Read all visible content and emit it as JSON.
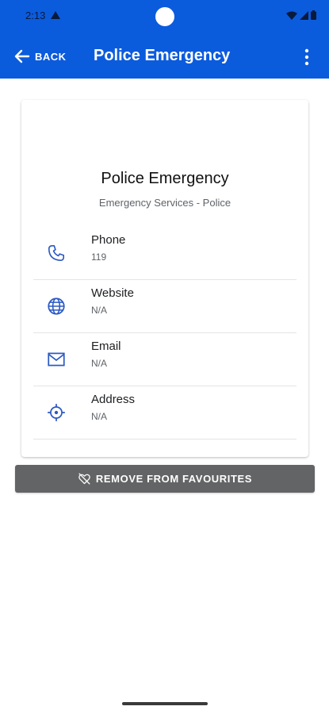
{
  "status_bar": {
    "time": "2:13"
  },
  "app_bar": {
    "back_label": "BACK",
    "title": "Police Emergency"
  },
  "card": {
    "title": "Police Emergency",
    "subtitle": "Emergency Services - Police",
    "rows": [
      {
        "label": "Phone",
        "value": "119",
        "icon": "phone-icon"
      },
      {
        "label": "Website",
        "value": "N/A",
        "icon": "globe-icon"
      },
      {
        "label": "Email",
        "value": "N/A",
        "icon": "mail-icon"
      },
      {
        "label": "Address",
        "value": "N/A",
        "icon": "location-icon"
      }
    ]
  },
  "actions": {
    "remove_label": "REMOVE FROM FAVOURITES"
  },
  "colors": {
    "primary": "#0b5bdd",
    "button": "#636466",
    "icon": "#2b59c3"
  }
}
